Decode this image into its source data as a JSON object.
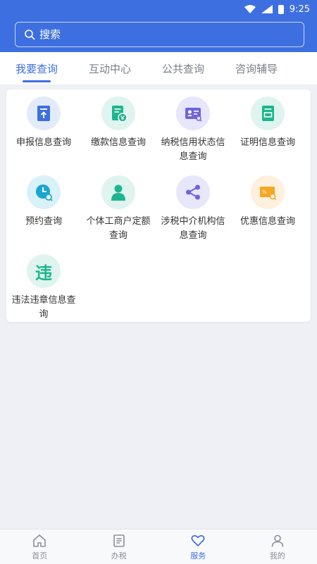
{
  "status": {
    "time": "9:25"
  },
  "search": {
    "placeholder": "搜索"
  },
  "tabs": [
    {
      "label": "我要查询",
      "active": true
    },
    {
      "label": "互动中心",
      "active": false
    },
    {
      "label": "公共查询",
      "active": false
    },
    {
      "label": "咨询辅导",
      "active": false
    }
  ],
  "items": [
    {
      "label": "申报信息查询",
      "icon": "document-upload-icon",
      "bg": "#e3ebfb",
      "fg": "#3d6fe0"
    },
    {
      "label": "缴款信息查询",
      "icon": "payment-document-icon",
      "bg": "#dff4ee",
      "fg": "#1db58f"
    },
    {
      "label": "纳税信用状态信息查询",
      "icon": "id-card-search-icon",
      "bg": "#e7e6fb",
      "fg": "#6f63dd"
    },
    {
      "label": "证明信息查询",
      "icon": "certificate-document-icon",
      "bg": "#dff4ee",
      "fg": "#1db58f"
    },
    {
      "label": "预约查询",
      "icon": "clock-search-icon",
      "bg": "#d9f1f8",
      "fg": "#19a6d1"
    },
    {
      "label": "个体工商户定额查询",
      "icon": "person-icon",
      "bg": "#dff4ee",
      "fg": "#1db58f"
    },
    {
      "label": "涉税中介机构信息查询",
      "icon": "share-nodes-icon",
      "bg": "#e7e6fb",
      "fg": "#6f63dd"
    },
    {
      "label": "优惠信息查询",
      "icon": "coupon-search-icon",
      "bg": "#fdf0dc",
      "fg": "#f5a623"
    },
    {
      "label": "违法违章信息查询",
      "icon": "violation-character-icon",
      "bg": "#dff4ee",
      "fg": "#1db58f",
      "glyph": "违"
    }
  ],
  "nav": [
    {
      "label": "首页",
      "icon": "home-icon",
      "active": false
    },
    {
      "label": "办税",
      "icon": "list-document-icon",
      "active": false
    },
    {
      "label": "服务",
      "icon": "heart-icon",
      "active": true
    },
    {
      "label": "我的",
      "icon": "user-icon",
      "active": false
    }
  ],
  "colors": {
    "primary": "#3d6fe0",
    "background": "#eef0f5"
  }
}
